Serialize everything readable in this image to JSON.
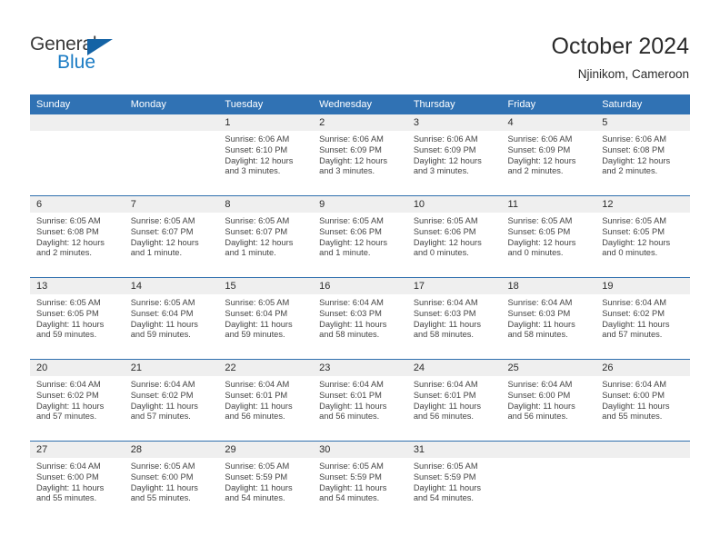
{
  "brand": {
    "name_part1": "General",
    "name_part2": "Blue",
    "triangle_color": "#1463a5",
    "blue_color": "#1a7bc4"
  },
  "header": {
    "title": "October 2024",
    "subtitle": "Njinikom, Cameroon",
    "accent_color": "#3072b4",
    "daynum_band_color": "#efefef"
  },
  "weekdays": [
    "Sunday",
    "Monday",
    "Tuesday",
    "Wednesday",
    "Thursday",
    "Friday",
    "Saturday"
  ],
  "weeks": [
    [
      {
        "day": "",
        "empty": true
      },
      {
        "day": "",
        "empty": true
      },
      {
        "day": "1",
        "sunrise": "Sunrise: 6:06 AM",
        "sunset": "Sunset: 6:10 PM",
        "daylight": "Daylight: 12 hours and 3 minutes."
      },
      {
        "day": "2",
        "sunrise": "Sunrise: 6:06 AM",
        "sunset": "Sunset: 6:09 PM",
        "daylight": "Daylight: 12 hours and 3 minutes."
      },
      {
        "day": "3",
        "sunrise": "Sunrise: 6:06 AM",
        "sunset": "Sunset: 6:09 PM",
        "daylight": "Daylight: 12 hours and 3 minutes."
      },
      {
        "day": "4",
        "sunrise": "Sunrise: 6:06 AM",
        "sunset": "Sunset: 6:09 PM",
        "daylight": "Daylight: 12 hours and 2 minutes."
      },
      {
        "day": "5",
        "sunrise": "Sunrise: 6:06 AM",
        "sunset": "Sunset: 6:08 PM",
        "daylight": "Daylight: 12 hours and 2 minutes."
      }
    ],
    [
      {
        "day": "6",
        "sunrise": "Sunrise: 6:05 AM",
        "sunset": "Sunset: 6:08 PM",
        "daylight": "Daylight: 12 hours and 2 minutes."
      },
      {
        "day": "7",
        "sunrise": "Sunrise: 6:05 AM",
        "sunset": "Sunset: 6:07 PM",
        "daylight": "Daylight: 12 hours and 1 minute."
      },
      {
        "day": "8",
        "sunrise": "Sunrise: 6:05 AM",
        "sunset": "Sunset: 6:07 PM",
        "daylight": "Daylight: 12 hours and 1 minute."
      },
      {
        "day": "9",
        "sunrise": "Sunrise: 6:05 AM",
        "sunset": "Sunset: 6:06 PM",
        "daylight": "Daylight: 12 hours and 1 minute."
      },
      {
        "day": "10",
        "sunrise": "Sunrise: 6:05 AM",
        "sunset": "Sunset: 6:06 PM",
        "daylight": "Daylight: 12 hours and 0 minutes."
      },
      {
        "day": "11",
        "sunrise": "Sunrise: 6:05 AM",
        "sunset": "Sunset: 6:05 PM",
        "daylight": "Daylight: 12 hours and 0 minutes."
      },
      {
        "day": "12",
        "sunrise": "Sunrise: 6:05 AM",
        "sunset": "Sunset: 6:05 PM",
        "daylight": "Daylight: 12 hours and 0 minutes."
      }
    ],
    [
      {
        "day": "13",
        "sunrise": "Sunrise: 6:05 AM",
        "sunset": "Sunset: 6:05 PM",
        "daylight": "Daylight: 11 hours and 59 minutes."
      },
      {
        "day": "14",
        "sunrise": "Sunrise: 6:05 AM",
        "sunset": "Sunset: 6:04 PM",
        "daylight": "Daylight: 11 hours and 59 minutes."
      },
      {
        "day": "15",
        "sunrise": "Sunrise: 6:05 AM",
        "sunset": "Sunset: 6:04 PM",
        "daylight": "Daylight: 11 hours and 59 minutes."
      },
      {
        "day": "16",
        "sunrise": "Sunrise: 6:04 AM",
        "sunset": "Sunset: 6:03 PM",
        "daylight": "Daylight: 11 hours and 58 minutes."
      },
      {
        "day": "17",
        "sunrise": "Sunrise: 6:04 AM",
        "sunset": "Sunset: 6:03 PM",
        "daylight": "Daylight: 11 hours and 58 minutes."
      },
      {
        "day": "18",
        "sunrise": "Sunrise: 6:04 AM",
        "sunset": "Sunset: 6:03 PM",
        "daylight": "Daylight: 11 hours and 58 minutes."
      },
      {
        "day": "19",
        "sunrise": "Sunrise: 6:04 AM",
        "sunset": "Sunset: 6:02 PM",
        "daylight": "Daylight: 11 hours and 57 minutes."
      }
    ],
    [
      {
        "day": "20",
        "sunrise": "Sunrise: 6:04 AM",
        "sunset": "Sunset: 6:02 PM",
        "daylight": "Daylight: 11 hours and 57 minutes."
      },
      {
        "day": "21",
        "sunrise": "Sunrise: 6:04 AM",
        "sunset": "Sunset: 6:02 PM",
        "daylight": "Daylight: 11 hours and 57 minutes."
      },
      {
        "day": "22",
        "sunrise": "Sunrise: 6:04 AM",
        "sunset": "Sunset: 6:01 PM",
        "daylight": "Daylight: 11 hours and 56 minutes."
      },
      {
        "day": "23",
        "sunrise": "Sunrise: 6:04 AM",
        "sunset": "Sunset: 6:01 PM",
        "daylight": "Daylight: 11 hours and 56 minutes."
      },
      {
        "day": "24",
        "sunrise": "Sunrise: 6:04 AM",
        "sunset": "Sunset: 6:01 PM",
        "daylight": "Daylight: 11 hours and 56 minutes."
      },
      {
        "day": "25",
        "sunrise": "Sunrise: 6:04 AM",
        "sunset": "Sunset: 6:00 PM",
        "daylight": "Daylight: 11 hours and 56 minutes."
      },
      {
        "day": "26",
        "sunrise": "Sunrise: 6:04 AM",
        "sunset": "Sunset: 6:00 PM",
        "daylight": "Daylight: 11 hours and 55 minutes."
      }
    ],
    [
      {
        "day": "27",
        "sunrise": "Sunrise: 6:04 AM",
        "sunset": "Sunset: 6:00 PM",
        "daylight": "Daylight: 11 hours and 55 minutes."
      },
      {
        "day": "28",
        "sunrise": "Sunrise: 6:05 AM",
        "sunset": "Sunset: 6:00 PM",
        "daylight": "Daylight: 11 hours and 55 minutes."
      },
      {
        "day": "29",
        "sunrise": "Sunrise: 6:05 AM",
        "sunset": "Sunset: 5:59 PM",
        "daylight": "Daylight: 11 hours and 54 minutes."
      },
      {
        "day": "30",
        "sunrise": "Sunrise: 6:05 AM",
        "sunset": "Sunset: 5:59 PM",
        "daylight": "Daylight: 11 hours and 54 minutes."
      },
      {
        "day": "31",
        "sunrise": "Sunrise: 6:05 AM",
        "sunset": "Sunset: 5:59 PM",
        "daylight": "Daylight: 11 hours and 54 minutes."
      },
      {
        "day": "",
        "empty": true
      },
      {
        "day": "",
        "empty": true
      }
    ]
  ]
}
